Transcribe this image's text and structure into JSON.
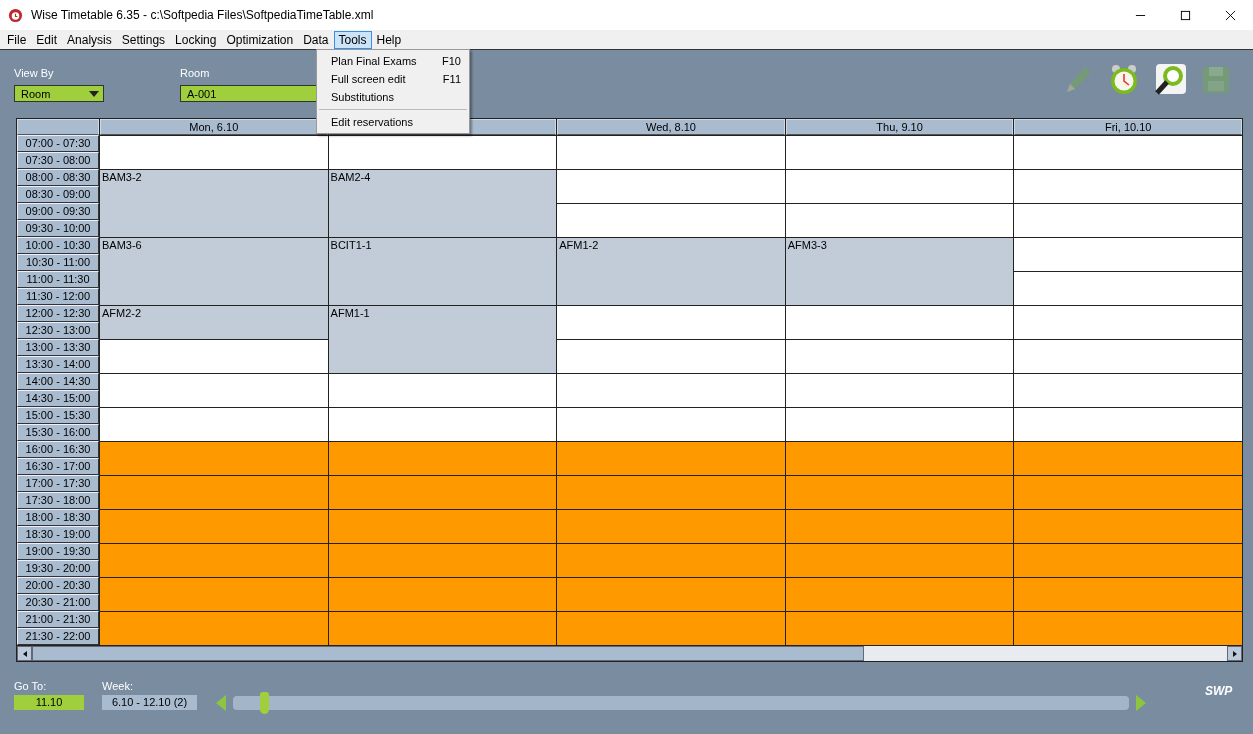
{
  "window": {
    "title": "Wise Timetable 6.35 - c:\\Softpedia Files\\SoftpediaTimeTable.xml"
  },
  "menu": [
    {
      "label": "File",
      "selected": false
    },
    {
      "label": "Edit",
      "selected": false
    },
    {
      "label": "Analysis",
      "selected": false
    },
    {
      "label": "Settings",
      "selected": false
    },
    {
      "label": "Locking",
      "selected": false
    },
    {
      "label": "Optimization",
      "selected": false
    },
    {
      "label": "Data",
      "selected": false
    },
    {
      "label": "Tools",
      "selected": true
    },
    {
      "label": "Help",
      "selected": false
    }
  ],
  "tools_menu": [
    {
      "label": "Plan Final Exams",
      "shortcut": "F10",
      "kind": "item"
    },
    {
      "label": "Full screen edit",
      "shortcut": "F11",
      "kind": "item"
    },
    {
      "label": "Substitutions",
      "kind": "item"
    },
    {
      "kind": "separator"
    },
    {
      "label": "Edit reservations",
      "kind": "item"
    }
  ],
  "view_by": {
    "label": "View By",
    "value": "Room"
  },
  "room": {
    "label": "Room",
    "value": "A-001"
  },
  "toolbar": [
    {
      "kind": "pencil",
      "disabled": true
    },
    {
      "kind": "clock",
      "disabled": false
    },
    {
      "kind": "search",
      "disabled": false
    },
    {
      "kind": "save",
      "disabled": true
    }
  ],
  "timetable": {
    "times": [
      "07:00 - 07:30",
      "07:30 - 08:00",
      "08:00 - 08:30",
      "08:30 - 09:00",
      "09:00 - 09:30",
      "09:30 - 10:00",
      "10:00 - 10:30",
      "10:30 - 11:00",
      "11:00 - 11:30",
      "11:30 - 12:00",
      "12:00 - 12:30",
      "12:30 - 13:00",
      "13:00 - 13:30",
      "13:30 - 14:00",
      "14:00 - 14:30",
      "14:30 - 15:00",
      "15:00 - 15:30",
      "15:30 - 16:00",
      "16:00 - 16:30",
      "16:30 - 17:00",
      "17:00 - 17:30",
      "17:30 - 18:00",
      "18:00 - 18:30",
      "18:30 - 19:00",
      "19:00 - 19:30",
      "19:30 - 20:00",
      "20:00 - 20:30",
      "20:30 - 21:00",
      "21:00 - 21:30",
      "21:30 - 22:00"
    ],
    "days": [
      {
        "label": "Mon, 6.10",
        "slots": [
          {
            "kind": "free",
            "joined": false
          },
          {
            "kind": "free",
            "joined": true
          },
          {
            "kind": "class",
            "label": "BAM3-2",
            "joined": false
          },
          {
            "kind": "class",
            "joined": true
          },
          {
            "kind": "class",
            "joined": true
          },
          {
            "kind": "class",
            "joined": true
          },
          {
            "kind": "class",
            "label": "BAM3-6",
            "joined": false
          },
          {
            "kind": "class",
            "joined": true
          },
          {
            "kind": "class",
            "joined": true
          },
          {
            "kind": "class",
            "joined": true
          },
          {
            "kind": "class",
            "label": "AFM2-2",
            "joined": false
          },
          {
            "kind": "class",
            "joined": true
          },
          {
            "kind": "free",
            "joined": false
          },
          {
            "kind": "free",
            "joined": true
          },
          {
            "kind": "free",
            "joined": false
          },
          {
            "kind": "free",
            "joined": true
          },
          {
            "kind": "free",
            "joined": false
          },
          {
            "kind": "free",
            "joined": true
          },
          {
            "kind": "blocked",
            "joined": false
          },
          {
            "kind": "blocked",
            "joined": true
          },
          {
            "kind": "blocked",
            "joined": false
          },
          {
            "kind": "blocked",
            "joined": true
          },
          {
            "kind": "blocked",
            "joined": false
          },
          {
            "kind": "blocked",
            "joined": true
          },
          {
            "kind": "blocked",
            "joined": false
          },
          {
            "kind": "blocked",
            "joined": true
          },
          {
            "kind": "blocked",
            "joined": false
          },
          {
            "kind": "blocked",
            "joined": true
          },
          {
            "kind": "blocked",
            "joined": false
          },
          {
            "kind": "blocked",
            "joined": true
          }
        ]
      },
      {
        "slots": [
          {
            "kind": "free",
            "joined": false
          },
          {
            "kind": "free",
            "joined": true
          },
          {
            "kind": "class",
            "label": "BAM2-4",
            "joined": false
          },
          {
            "kind": "class",
            "joined": true
          },
          {
            "kind": "class",
            "joined": true
          },
          {
            "kind": "class",
            "joined": true
          },
          {
            "kind": "class",
            "label": "BCIT1-1",
            "joined": false
          },
          {
            "kind": "class",
            "joined": true
          },
          {
            "kind": "class",
            "joined": true
          },
          {
            "kind": "class",
            "joined": true
          },
          {
            "kind": "class",
            "label": "AFM1-1",
            "joined": false
          },
          {
            "kind": "class",
            "joined": true
          },
          {
            "kind": "class",
            "joined": true
          },
          {
            "kind": "class",
            "joined": true
          },
          {
            "kind": "free",
            "joined": false
          },
          {
            "kind": "free",
            "joined": true
          },
          {
            "kind": "free",
            "joined": false
          },
          {
            "kind": "free",
            "joined": true
          },
          {
            "kind": "blocked",
            "joined": false
          },
          {
            "kind": "blocked",
            "joined": true
          },
          {
            "kind": "blocked",
            "joined": false
          },
          {
            "kind": "blocked",
            "joined": true
          },
          {
            "kind": "blocked",
            "joined": false
          },
          {
            "kind": "blocked",
            "joined": true
          },
          {
            "kind": "blocked",
            "joined": false
          },
          {
            "kind": "blocked",
            "joined": true
          },
          {
            "kind": "blocked",
            "joined": false
          },
          {
            "kind": "blocked",
            "joined": true
          },
          {
            "kind": "blocked",
            "joined": false
          },
          {
            "kind": "blocked",
            "joined": true
          }
        ]
      },
      {
        "label": "Wed, 8.10",
        "slots": [
          {
            "kind": "free",
            "joined": false
          },
          {
            "kind": "free",
            "joined": true
          },
          {
            "kind": "free",
            "joined": false
          },
          {
            "kind": "free",
            "joined": true
          },
          {
            "kind": "free",
            "joined": false
          },
          {
            "kind": "free",
            "joined": true
          },
          {
            "kind": "class",
            "label": "AFM1-2",
            "joined": false
          },
          {
            "kind": "class",
            "joined": true
          },
          {
            "kind": "class",
            "joined": true
          },
          {
            "kind": "class",
            "joined": true
          },
          {
            "kind": "free",
            "joined": false
          },
          {
            "kind": "free",
            "joined": true
          },
          {
            "kind": "free",
            "joined": false
          },
          {
            "kind": "free",
            "joined": true
          },
          {
            "kind": "free",
            "joined": false
          },
          {
            "kind": "free",
            "joined": true
          },
          {
            "kind": "free",
            "joined": false
          },
          {
            "kind": "free",
            "joined": true
          },
          {
            "kind": "blocked",
            "joined": false
          },
          {
            "kind": "blocked",
            "joined": true
          },
          {
            "kind": "blocked",
            "joined": false
          },
          {
            "kind": "blocked",
            "joined": true
          },
          {
            "kind": "blocked",
            "joined": false
          },
          {
            "kind": "blocked",
            "joined": true
          },
          {
            "kind": "blocked",
            "joined": false
          },
          {
            "kind": "blocked",
            "joined": true
          },
          {
            "kind": "blocked",
            "joined": false
          },
          {
            "kind": "blocked",
            "joined": true
          },
          {
            "kind": "blocked",
            "joined": false
          },
          {
            "kind": "blocked",
            "joined": true
          }
        ]
      },
      {
        "label": "Thu, 9.10",
        "slots": [
          {
            "kind": "free",
            "joined": false
          },
          {
            "kind": "free",
            "joined": true
          },
          {
            "kind": "free",
            "joined": false
          },
          {
            "kind": "free",
            "joined": true
          },
          {
            "kind": "free",
            "joined": false
          },
          {
            "kind": "free",
            "joined": true
          },
          {
            "kind": "class",
            "label": "AFM3-3",
            "joined": false
          },
          {
            "kind": "class",
            "joined": true
          },
          {
            "kind": "class",
            "joined": true
          },
          {
            "kind": "class",
            "joined": true
          },
          {
            "kind": "free",
            "joined": false
          },
          {
            "kind": "free",
            "joined": true
          },
          {
            "kind": "free",
            "joined": false
          },
          {
            "kind": "free",
            "joined": true
          },
          {
            "kind": "free",
            "joined": false
          },
          {
            "kind": "free",
            "joined": true
          },
          {
            "kind": "free",
            "joined": false
          },
          {
            "kind": "free",
            "joined": true
          },
          {
            "kind": "blocked",
            "joined": false
          },
          {
            "kind": "blocked",
            "joined": true
          },
          {
            "kind": "blocked",
            "joined": false
          },
          {
            "kind": "blocked",
            "joined": true
          },
          {
            "kind": "blocked",
            "joined": false
          },
          {
            "kind": "blocked",
            "joined": true
          },
          {
            "kind": "blocked",
            "joined": false
          },
          {
            "kind": "blocked",
            "joined": true
          },
          {
            "kind": "blocked",
            "joined": false
          },
          {
            "kind": "blocked",
            "joined": true
          },
          {
            "kind": "blocked",
            "joined": false
          },
          {
            "kind": "blocked",
            "joined": true
          }
        ]
      },
      {
        "label": "Fri, 10.10",
        "slots": [
          {
            "kind": "free",
            "joined": false
          },
          {
            "kind": "free",
            "joined": true
          },
          {
            "kind": "free",
            "joined": false
          },
          {
            "kind": "free",
            "joined": true
          },
          {
            "kind": "free",
            "joined": false
          },
          {
            "kind": "free",
            "joined": true
          },
          {
            "kind": "free",
            "joined": false
          },
          {
            "kind": "free",
            "joined": true
          },
          {
            "kind": "free",
            "joined": false
          },
          {
            "kind": "free",
            "joined": true
          },
          {
            "kind": "free",
            "joined": false
          },
          {
            "kind": "free",
            "joined": true
          },
          {
            "kind": "free",
            "joined": false
          },
          {
            "kind": "free",
            "joined": true
          },
          {
            "kind": "free",
            "joined": false
          },
          {
            "kind": "free",
            "joined": true
          },
          {
            "kind": "free",
            "joined": false
          },
          {
            "kind": "free",
            "joined": true
          },
          {
            "kind": "blocked",
            "joined": false
          },
          {
            "kind": "blocked",
            "joined": true
          },
          {
            "kind": "blocked",
            "joined": false
          },
          {
            "kind": "blocked",
            "joined": true
          },
          {
            "kind": "blocked",
            "joined": false
          },
          {
            "kind": "blocked",
            "joined": true
          },
          {
            "kind": "blocked",
            "joined": false
          },
          {
            "kind": "blocked",
            "joined": true
          },
          {
            "kind": "blocked",
            "joined": false
          },
          {
            "kind": "blocked",
            "joined": true
          },
          {
            "kind": "blocked",
            "joined": false
          },
          {
            "kind": "blocked",
            "joined": true
          }
        ]
      }
    ]
  },
  "go_to": {
    "label": "Go To:",
    "value": "11.10"
  },
  "week": {
    "label": "Week:",
    "value": "6.10 - 12.10  (2)"
  },
  "week_slider": {
    "level": 0.03
  },
  "logo": "SWP"
}
